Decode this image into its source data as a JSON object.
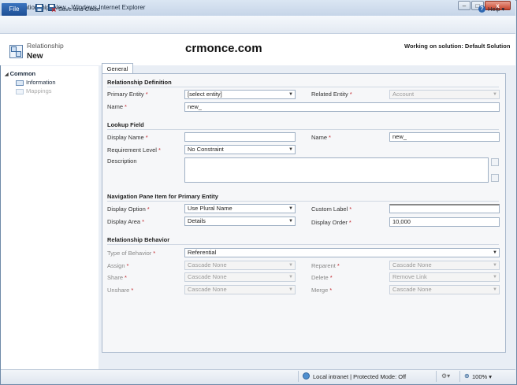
{
  "window": {
    "title": "Relationship: New - Windows Internet Explorer",
    "minimize": "–",
    "maximize": "□",
    "close": "x"
  },
  "ribbon": {
    "file_label": "File",
    "save_close_label": "Save and Close",
    "help_label": "Help",
    "help_caret": "▾"
  },
  "header": {
    "entity_type": "Relationship",
    "record_name": "New",
    "watermark": "crmonce.com",
    "solution_text": "Working on solution: Default Solution"
  },
  "nav": {
    "group_label": "Common",
    "group_toggle": "◢",
    "items": [
      {
        "label": "Information",
        "enabled": true
      },
      {
        "label": "Mappings",
        "enabled": false
      }
    ]
  },
  "tabs": [
    {
      "label": "General"
    }
  ],
  "form": {
    "relationship_definition": {
      "title": "Relationship Definition",
      "primary_entity": {
        "label": "Primary Entity",
        "value": "[select entity]"
      },
      "related_entity": {
        "label": "Related Entity",
        "value": "Account"
      },
      "name": {
        "label": "Name",
        "value": "new_"
      }
    },
    "lookup_field": {
      "title": "Lookup Field",
      "display_name": {
        "label": "Display Name",
        "value": ""
      },
      "name": {
        "label": "Name",
        "value": "new_"
      },
      "requirement_level": {
        "label": "Requirement Level",
        "value": "No Constraint"
      },
      "description": {
        "label": "Description",
        "value": ""
      }
    },
    "navigation_pane": {
      "title": "Navigation Pane Item for Primary Entity",
      "display_option": {
        "label": "Display Option",
        "value": "Use Plural Name"
      },
      "custom_label": {
        "label": "Custom Label",
        "value": ""
      },
      "display_area": {
        "label": "Display Area",
        "value": "Details"
      },
      "display_order": {
        "label": "Display Order",
        "value": "10,000"
      }
    },
    "relationship_behavior": {
      "title": "Relationship Behavior",
      "type_of_behavior": {
        "label": "Type of Behavior",
        "value": "Referential"
      },
      "assign": {
        "label": "Assign",
        "value": "Cascade None"
      },
      "reparent": {
        "label": "Reparent",
        "value": "Cascade None"
      },
      "share": {
        "label": "Share",
        "value": "Cascade None"
      },
      "delete": {
        "label": "Delete",
        "value": "Remove Link"
      },
      "unshare": {
        "label": "Unshare",
        "value": "Cascade None"
      },
      "merge": {
        "label": "Merge",
        "value": "Cascade None"
      }
    }
  },
  "statusbar": {
    "zone_text": "Local intranet | Protected Mode: Off",
    "zoom": "100%"
  },
  "colors": {
    "required_asterisk": "#c1272d",
    "file_button": "#2a5fa8",
    "panel_border": "#a9b8cc"
  }
}
